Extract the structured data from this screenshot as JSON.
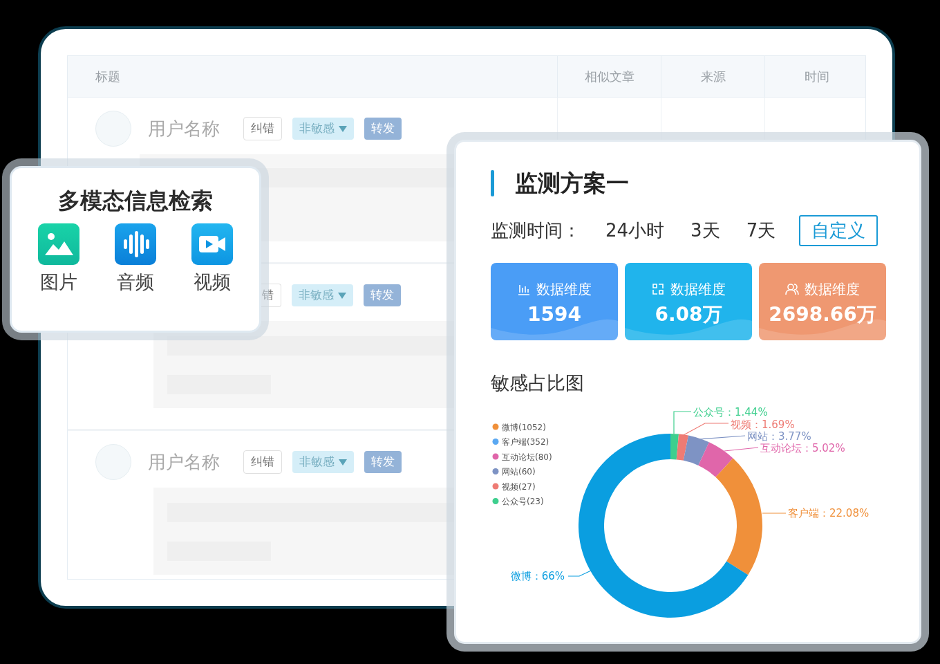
{
  "table": {
    "columns": [
      "标题",
      "相似文章",
      "来源",
      "时间"
    ],
    "rows": [
      {
        "name": "用户名称",
        "tags": [
          {
            "kind": "correct",
            "label": "纠错"
          },
          {
            "kind": "sensitivity",
            "label": "非敏感"
          },
          {
            "kind": "forward",
            "label": "转发"
          }
        ]
      },
      {
        "tags": [
          {
            "kind": "correct",
            "label": "错"
          },
          {
            "kind": "sensitivity",
            "label": "非敏感"
          },
          {
            "kind": "forward",
            "label": "转发"
          }
        ]
      },
      {
        "name": "用户名称",
        "tags": [
          {
            "kind": "correct",
            "label": "纠错"
          },
          {
            "kind": "sensitivity",
            "label": "非敏感"
          },
          {
            "kind": "forward",
            "label": "转发"
          }
        ]
      }
    ]
  },
  "search_card": {
    "title": "多模态信息检索",
    "items": [
      {
        "kind": "image",
        "label": "图片"
      },
      {
        "kind": "audio",
        "label": "音频"
      },
      {
        "kind": "video",
        "label": "视频"
      }
    ]
  },
  "monitor_card": {
    "title": "监测方案一",
    "time_label": "监测时间：",
    "time_options": [
      {
        "label": "24小时",
        "selected": false
      },
      {
        "label": "3天",
        "selected": false
      },
      {
        "label": "7天",
        "selected": false
      },
      {
        "label": "自定义",
        "selected": true
      }
    ],
    "stats": [
      {
        "kind": "bars",
        "label": "数据维度",
        "value": "1594",
        "color": "#4a9df6"
      },
      {
        "kind": "exchange",
        "label": "数据维度",
        "value": "6.08万",
        "color": "#20b4ec"
      },
      {
        "kind": "users",
        "label": "数据维度",
        "value": "2698.66万",
        "color": "#ef9871"
      }
    ],
    "chart_title": "敏感占比图",
    "legend": [
      {
        "label": "微博(1052)",
        "color": "#f0903a"
      },
      {
        "label": "客户端(352)",
        "color": "#5aa8f2"
      },
      {
        "label": "互动论坛(80)",
        "color": "#e066aa"
      },
      {
        "label": "网站(60)",
        "color": "#7e93c4"
      },
      {
        "label": "视频(27)",
        "color": "#ee7b74"
      },
      {
        "label": "公众号(23)",
        "color": "#3ecf8e"
      }
    ],
    "slice_labels": [
      {
        "label": "公众号：1.44%",
        "color": "#3ecf8e"
      },
      {
        "label": "视频：1.69%",
        "color": "#ee7b74"
      },
      {
        "label": "网站：3.77%",
        "color": "#7e93c4"
      },
      {
        "label": "互动论坛：5.02%",
        "color": "#e066aa"
      },
      {
        "label": "客户端：22.08%",
        "color": "#f0903a"
      },
      {
        "label": "微博：66%",
        "color": "#0a9ee0"
      }
    ],
    "chart_data": {
      "type": "donut",
      "values": [
        1.44,
        1.69,
        3.77,
        5.02,
        22.08,
        66
      ],
      "colors": [
        "#3ecf8e",
        "#ee7b74",
        "#7e93c4",
        "#e066aa",
        "#f0903a",
        "#0a9ee0"
      ]
    }
  }
}
